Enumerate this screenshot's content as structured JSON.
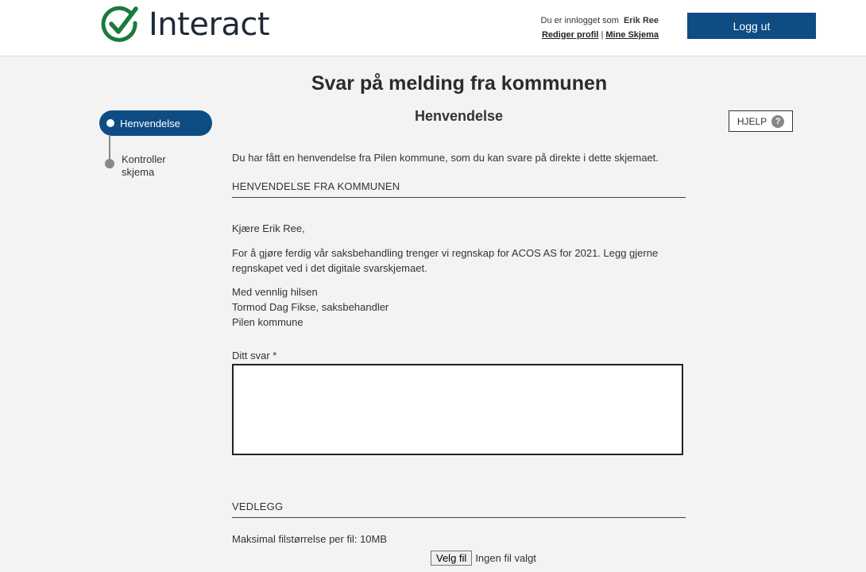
{
  "header": {
    "logo_text": "Interact",
    "logged_in_label": "Du er innlogget som",
    "user_name": "Erik Ree",
    "edit_profile": "Rediger profil",
    "separator": "|",
    "my_forms": "Mine Skjema",
    "logout_label": "Logg ut"
  },
  "page": {
    "title": "Svar på melding fra kommunen"
  },
  "steps": {
    "active": "Henvendelse",
    "next": "Kontroller skjema"
  },
  "section": {
    "title": "Henvendelse"
  },
  "help": {
    "label": "HJELP",
    "icon": "?"
  },
  "content": {
    "intro": "Du har fått en henvendelse fra Pilen kommune, som du kan svare på direkte i dette skjemaet.",
    "heading_inquiry": "HENVENDELSE FRA KOMMUNEN",
    "greeting": "Kjære Erik Ree,",
    "body_line1": "For å gjøre ferdig vår saksbehandling trenger vi regnskap for ACOS AS for 2021. Legg gjerne",
    "body_line2": "regnskapet ved i det digitale svarskjemaet.",
    "sign1": "Med vennlig hilsen",
    "sign2": "Tormod Dag Fikse, saksbehandler",
    "sign3": "Pilen kommune",
    "answer_label": "Ditt svar *",
    "answer_value": "",
    "heading_attachments": "VEDLEGG",
    "max_size": "Maksimal filstørrelse per fil: 10MB",
    "choose_file": "Velg fil",
    "no_file": "Ingen fil valgt"
  },
  "colors": {
    "brand_blue": "#0e4c84",
    "logo_green": "#1b7a3e"
  }
}
